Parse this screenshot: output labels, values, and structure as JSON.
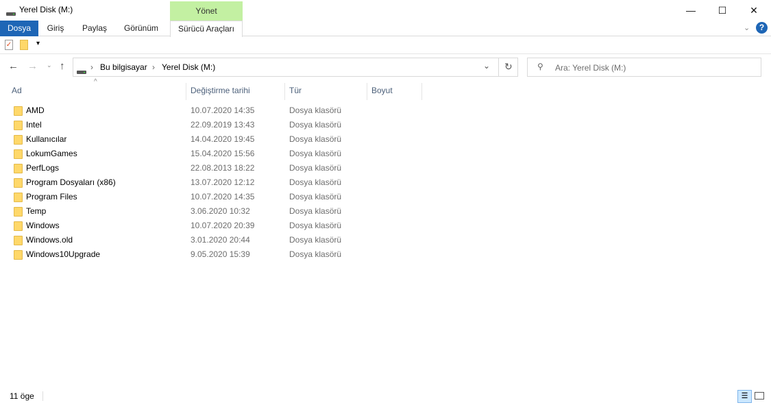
{
  "window": {
    "title": "Yerel Disk (M:)",
    "minimize": "—",
    "maximize": "☐",
    "close": "✕"
  },
  "ribbon": {
    "context_group": "Yönet",
    "tabs": [
      "Dosya",
      "Giriş",
      "Paylaş",
      "Görünüm",
      "Sürücü Araçları"
    ],
    "help": "?"
  },
  "address": {
    "path": [
      "Bu bilgisayar",
      "Yerel Disk (M:)"
    ]
  },
  "search": {
    "placeholder": "Ara: Yerel Disk (M:)"
  },
  "columns": [
    "Ad",
    "Değiştirme tarihi",
    "Tür",
    "Boyut"
  ],
  "files": [
    {
      "name": "AMD",
      "date": "10.07.2020 14:35",
      "type": "Dosya klasörü"
    },
    {
      "name": "Intel",
      "date": "22.09.2019 13:43",
      "type": "Dosya klasörü"
    },
    {
      "name": "Kullanıcılar",
      "date": "14.04.2020 19:45",
      "type": "Dosya klasörü"
    },
    {
      "name": "LokumGames",
      "date": "15.04.2020 15:56",
      "type": "Dosya klasörü"
    },
    {
      "name": "PerfLogs",
      "date": "22.08.2013 18:22",
      "type": "Dosya klasörü"
    },
    {
      "name": "Program Dosyaları (x86)",
      "date": "13.07.2020 12:12",
      "type": "Dosya klasörü"
    },
    {
      "name": "Program Files",
      "date": "10.07.2020 14:35",
      "type": "Dosya klasörü"
    },
    {
      "name": "Temp",
      "date": "3.06.2020 10:32",
      "type": "Dosya klasörü"
    },
    {
      "name": "Windows",
      "date": "10.07.2020 20:39",
      "type": "Dosya klasörü"
    },
    {
      "name": "Windows.old",
      "date": "3.01.2020 20:44",
      "type": "Dosya klasörü"
    },
    {
      "name": "Windows10Upgrade",
      "date": "9.05.2020 15:39",
      "type": "Dosya klasörü"
    }
  ],
  "status": {
    "count": "11 öge"
  }
}
